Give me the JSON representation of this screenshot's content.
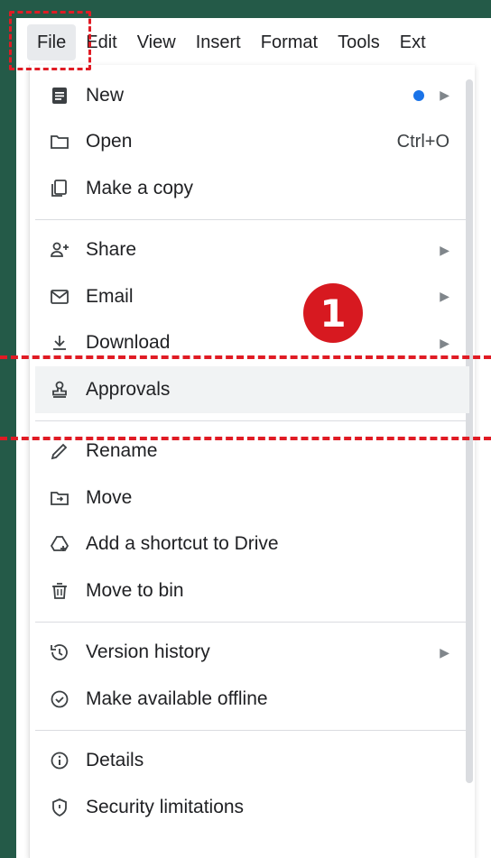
{
  "menubar": {
    "items": [
      "File",
      "Edit",
      "View",
      "Insert",
      "Format",
      "Tools",
      "Ext"
    ]
  },
  "file_menu": {
    "groups": [
      [
        {
          "icon": "document-icon",
          "label": "New",
          "dot": true,
          "submenu": true
        },
        {
          "icon": "folder-open-icon",
          "label": "Open",
          "shortcut": "Ctrl+O"
        },
        {
          "icon": "copy-icon",
          "label": "Make a copy"
        }
      ],
      [
        {
          "icon": "share-person-add-icon",
          "label": "Share",
          "submenu": true
        },
        {
          "icon": "email-icon",
          "label": "Email",
          "submenu": true
        },
        {
          "icon": "download-icon",
          "label": "Download",
          "submenu": true
        },
        {
          "icon": "approvals-stamp-icon",
          "label": "Approvals",
          "highlighted": true
        }
      ],
      [
        {
          "icon": "pencil-icon",
          "label": "Rename"
        },
        {
          "icon": "move-folder-icon",
          "label": "Move"
        },
        {
          "icon": "drive-shortcut-icon",
          "label": "Add a shortcut to Drive"
        },
        {
          "icon": "trash-icon",
          "label": "Move to bin"
        }
      ],
      [
        {
          "icon": "history-icon",
          "label": "Version history",
          "submenu": true
        },
        {
          "icon": "offline-check-icon",
          "label": "Make available offline"
        }
      ],
      [
        {
          "icon": "info-icon",
          "label": "Details"
        },
        {
          "icon": "security-shield-icon",
          "label": "Security limitations"
        }
      ]
    ]
  },
  "annotation": {
    "step_number": "1",
    "accent_color": "#e01b24"
  }
}
